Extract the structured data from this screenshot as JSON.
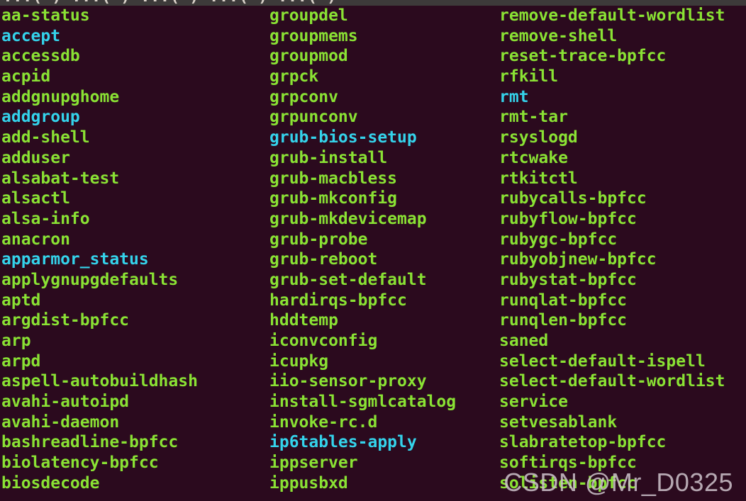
{
  "terminal": {
    "background_color": "#2b0a1e",
    "green_color": "#8ae234",
    "cyan_color": "#34d3eb",
    "top_strip_color": "#3d3a3a",
    "top_strip_partial_text": "...( ) ...( ) ...( ) ...( ) ...( )",
    "columns": [
      {
        "name": "column-1",
        "entries": [
          {
            "text": "aa-status",
            "color": "green"
          },
          {
            "text": "accept",
            "color": "cyan"
          },
          {
            "text": "accessdb",
            "color": "green"
          },
          {
            "text": "acpid",
            "color": "green"
          },
          {
            "text": "addgnupghome",
            "color": "green"
          },
          {
            "text": "addgroup",
            "color": "cyan"
          },
          {
            "text": "add-shell",
            "color": "green"
          },
          {
            "text": "adduser",
            "color": "green"
          },
          {
            "text": "alsabat-test",
            "color": "green"
          },
          {
            "text": "alsactl",
            "color": "green"
          },
          {
            "text": "alsa-info",
            "color": "green"
          },
          {
            "text": "anacron",
            "color": "green"
          },
          {
            "text": "apparmor_status",
            "color": "cyan"
          },
          {
            "text": "applygnupgdefaults",
            "color": "green"
          },
          {
            "text": "aptd",
            "color": "green"
          },
          {
            "text": "argdist-bpfcc",
            "color": "green"
          },
          {
            "text": "arp",
            "color": "green"
          },
          {
            "text": "arpd",
            "color": "green"
          },
          {
            "text": "aspell-autobuildhash",
            "color": "green"
          },
          {
            "text": "avahi-autoipd",
            "color": "green"
          },
          {
            "text": "avahi-daemon",
            "color": "green"
          },
          {
            "text": "bashreadline-bpfcc",
            "color": "green"
          },
          {
            "text": "biolatency-bpfcc",
            "color": "green"
          },
          {
            "text": "biosdecode",
            "color": "green"
          }
        ]
      },
      {
        "name": "column-2",
        "entries": [
          {
            "text": "groupdel",
            "color": "green"
          },
          {
            "text": "groupmems",
            "color": "green"
          },
          {
            "text": "groupmod",
            "color": "green"
          },
          {
            "text": "grpck",
            "color": "green"
          },
          {
            "text": "grpconv",
            "color": "green"
          },
          {
            "text": "grpunconv",
            "color": "green"
          },
          {
            "text": "grub-bios-setup",
            "color": "cyan"
          },
          {
            "text": "grub-install",
            "color": "green"
          },
          {
            "text": "grub-macbless",
            "color": "green"
          },
          {
            "text": "grub-mkconfig",
            "color": "green"
          },
          {
            "text": "grub-mkdevicemap",
            "color": "green"
          },
          {
            "text": "grub-probe",
            "color": "green"
          },
          {
            "text": "grub-reboot",
            "color": "green"
          },
          {
            "text": "grub-set-default",
            "color": "green"
          },
          {
            "text": "hardirqs-bpfcc",
            "color": "green"
          },
          {
            "text": "hddtemp",
            "color": "green"
          },
          {
            "text": "iconvconfig",
            "color": "green"
          },
          {
            "text": "icupkg",
            "color": "green"
          },
          {
            "text": "iio-sensor-proxy",
            "color": "green"
          },
          {
            "text": "install-sgmlcatalog",
            "color": "green"
          },
          {
            "text": "invoke-rc.d",
            "color": "green"
          },
          {
            "text": "ip6tables-apply",
            "color": "cyan"
          },
          {
            "text": "ippserver",
            "color": "green"
          },
          {
            "text": "ippusbxd",
            "color": "green"
          }
        ]
      },
      {
        "name": "column-3",
        "entries": [
          {
            "text": "remove-default-wordlist",
            "color": "green"
          },
          {
            "text": "remove-shell",
            "color": "green"
          },
          {
            "text": "reset-trace-bpfcc",
            "color": "green"
          },
          {
            "text": "rfkill",
            "color": "green"
          },
          {
            "text": "rmt",
            "color": "cyan"
          },
          {
            "text": "rmt-tar",
            "color": "green"
          },
          {
            "text": "rsyslogd",
            "color": "green"
          },
          {
            "text": "rtcwake",
            "color": "green"
          },
          {
            "text": "rtkitctl",
            "color": "green"
          },
          {
            "text": "rubycalls-bpfcc",
            "color": "green"
          },
          {
            "text": "rubyflow-bpfcc",
            "color": "green"
          },
          {
            "text": "rubygc-bpfcc",
            "color": "green"
          },
          {
            "text": "rubyobjnew-bpfcc",
            "color": "green"
          },
          {
            "text": "rubystat-bpfcc",
            "color": "green"
          },
          {
            "text": "runqlat-bpfcc",
            "color": "green"
          },
          {
            "text": "runqlen-bpfcc",
            "color": "green"
          },
          {
            "text": "saned",
            "color": "green"
          },
          {
            "text": "select-default-ispell",
            "color": "green"
          },
          {
            "text": "select-default-wordlist",
            "color": "green"
          },
          {
            "text": "service",
            "color": "green"
          },
          {
            "text": "setvesablank",
            "color": "green"
          },
          {
            "text": "slabratetop-bpfcc",
            "color": "green"
          },
          {
            "text": "softirqs-bpfcc",
            "color": "green"
          },
          {
            "text": "solisten-bpfcc",
            "color": "green"
          }
        ]
      }
    ]
  },
  "watermark": {
    "text": "CSDN @Mr_D0325",
    "color": "#cdc3cb"
  }
}
